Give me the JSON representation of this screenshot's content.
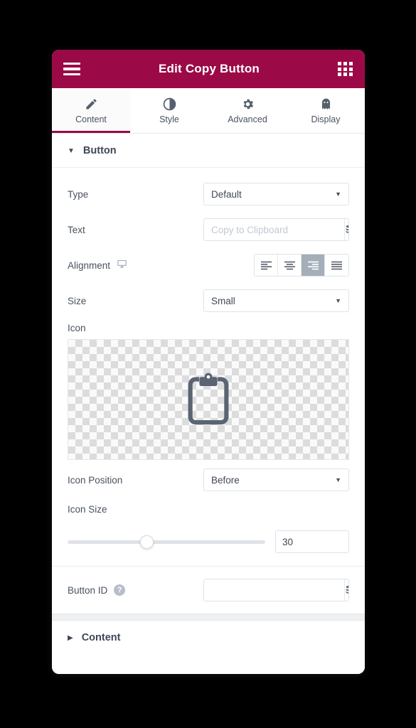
{
  "header": {
    "title": "Edit Copy Button",
    "menu_icon": "hamburger-menu-icon",
    "apps_icon": "grid-apps-icon",
    "color": "#9B0A46"
  },
  "tabs": [
    {
      "label": "Content",
      "icon": "pencil-icon",
      "active": true
    },
    {
      "label": "Style",
      "icon": "contrast-circle-icon",
      "active": false
    },
    {
      "label": "Advanced",
      "icon": "gear-icon",
      "active": false
    },
    {
      "label": "Display",
      "icon": "ghost-icon",
      "active": false
    }
  ],
  "sections": {
    "button": {
      "title": "Button",
      "expanded": true,
      "caret": "caret-down-icon"
    },
    "content": {
      "title": "Content",
      "expanded": false,
      "caret": "caret-right-icon"
    }
  },
  "fields": {
    "type": {
      "label": "Type",
      "value": "Default"
    },
    "text": {
      "label": "Text",
      "value": "",
      "placeholder": "Copy to Clipboard"
    },
    "alignment": {
      "label": "Alignment",
      "device_icon": "desktop-monitor-icon",
      "options": [
        "left",
        "center",
        "right",
        "justify"
      ],
      "selected": "right"
    },
    "size": {
      "label": "Size",
      "value": "Small"
    },
    "icon": {
      "label": "Icon",
      "preview_icon": "clipboard-icon"
    },
    "icon_position": {
      "label": "Icon Position",
      "value": "Before"
    },
    "icon_size": {
      "label": "Icon Size",
      "value": "30",
      "percent": 40
    },
    "button_id": {
      "label": "Button ID",
      "value": "",
      "placeholder": "",
      "help_icon": "question-mark-icon"
    }
  },
  "dynamic_tag_icon": "database-dynamic-tag-icon"
}
